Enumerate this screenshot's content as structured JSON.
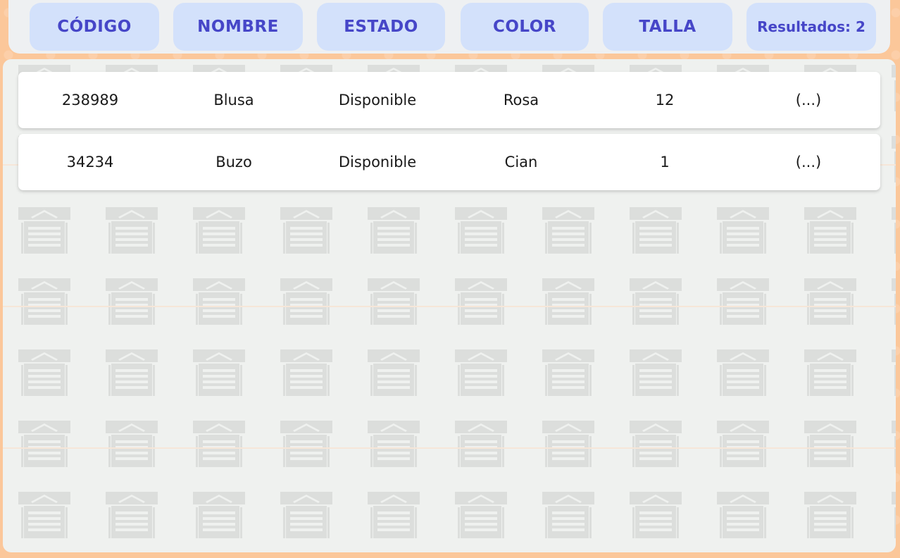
{
  "header": {
    "codigo": "CÓDIGO",
    "nombre": "NOMBRE",
    "estado": "ESTADO",
    "color": "COLOR",
    "talla": "TALLA",
    "results": "Resultados: 2"
  },
  "results": [
    {
      "codigo": "238989",
      "nombre": "Blusa",
      "estado": "Disponible",
      "color": "Rosa",
      "talla": "12",
      "more": "(...)"
    },
    {
      "codigo": "34234",
      "nombre": "Buzo",
      "estado": "Disponible",
      "color": "Cian",
      "talla": "1",
      "more": "(...)"
    }
  ],
  "colors": {
    "page_background": "#fbc79a",
    "header_bar": "#eef0f2",
    "header_button": "#d3e1fb",
    "header_text": "#4646c8",
    "panel_background": "#eff1ef",
    "pattern_icons": "#dcdedc",
    "row_background": "#ffffff"
  },
  "icons": [
    "garage-door-icon",
    "box-icon",
    "shelf-icon"
  ]
}
